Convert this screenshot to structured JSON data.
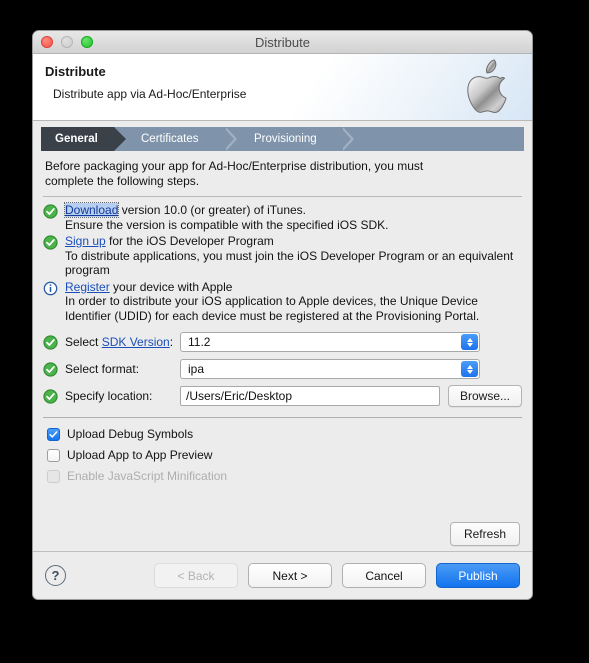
{
  "window": {
    "title": "Distribute",
    "traffic_lights": [
      "close-button",
      "minimize-button",
      "zoom-button"
    ]
  },
  "header": {
    "title": "Distribute",
    "subtitle": "Distribute app via Ad-Hoc/Enterprise",
    "logo": "apple-logo"
  },
  "steps": [
    {
      "label": "General",
      "active": true
    },
    {
      "label": "Certificates",
      "active": false
    },
    {
      "label": "Provisioning",
      "active": false
    }
  ],
  "intro": "Before packaging your app for Ad-Hoc/Enterprise distribution, you must complete the following steps.",
  "checklist": [
    {
      "icon": "green-check-icon",
      "link": "Download",
      "link_selected": true,
      "title_rest": " version 10.0 (or greater) of iTunes.",
      "detail": "Ensure the version is compatible with the specified iOS SDK."
    },
    {
      "icon": "green-check-icon",
      "link": "Sign up",
      "link_selected": false,
      "title_rest": " for the iOS Developer Program",
      "detail": "To distribute applications, you must join the iOS Developer Program or an equivalent program"
    },
    {
      "icon": "blue-info-icon",
      "link": "Register",
      "link_selected": false,
      "title_rest": " your device with Apple",
      "detail": "In order to distribute your iOS application to Apple devices, the Unique Device Identifier (UDID) for each device must be registered at the Provisioning Portal."
    }
  ],
  "form": {
    "sdk": {
      "label_prefix": "Select ",
      "label_link": "SDK Version",
      "label_suffix": ":",
      "value": "11.2",
      "icon": "green-check-icon"
    },
    "format": {
      "label": "Select format:",
      "value": "ipa",
      "icon": "green-check-icon"
    },
    "location": {
      "label": "Specify location:",
      "value": "/Users/Eric/Desktop",
      "placeholder": "/Users/Eric/Desktop",
      "browse_label": "Browse...",
      "icon": "green-check-icon"
    }
  },
  "checkboxes": [
    {
      "label": "Upload Debug Symbols",
      "checked": true,
      "disabled": false
    },
    {
      "label": "Upload App to App Preview",
      "checked": false,
      "disabled": false
    },
    {
      "label": "Enable JavaScript Minification",
      "checked": false,
      "disabled": true
    }
  ],
  "refresh_label": "Refresh",
  "footer": {
    "help": "?",
    "buttons": [
      {
        "label": "< Back",
        "disabled": true,
        "primary": false
      },
      {
        "label": "Next >",
        "disabled": false,
        "primary": false
      },
      {
        "label": "Cancel",
        "disabled": false,
        "primary": false
      },
      {
        "label": "Publish",
        "disabled": false,
        "primary": true
      }
    ]
  },
  "colors": {
    "accent_blue": "#1274ee",
    "link_blue": "#1a4fbb",
    "step_active_bg": "#3b4148",
    "step_bar_bg": "#7f94ab",
    "check_green": "#3aa63a",
    "window_bg": "#ececec"
  }
}
